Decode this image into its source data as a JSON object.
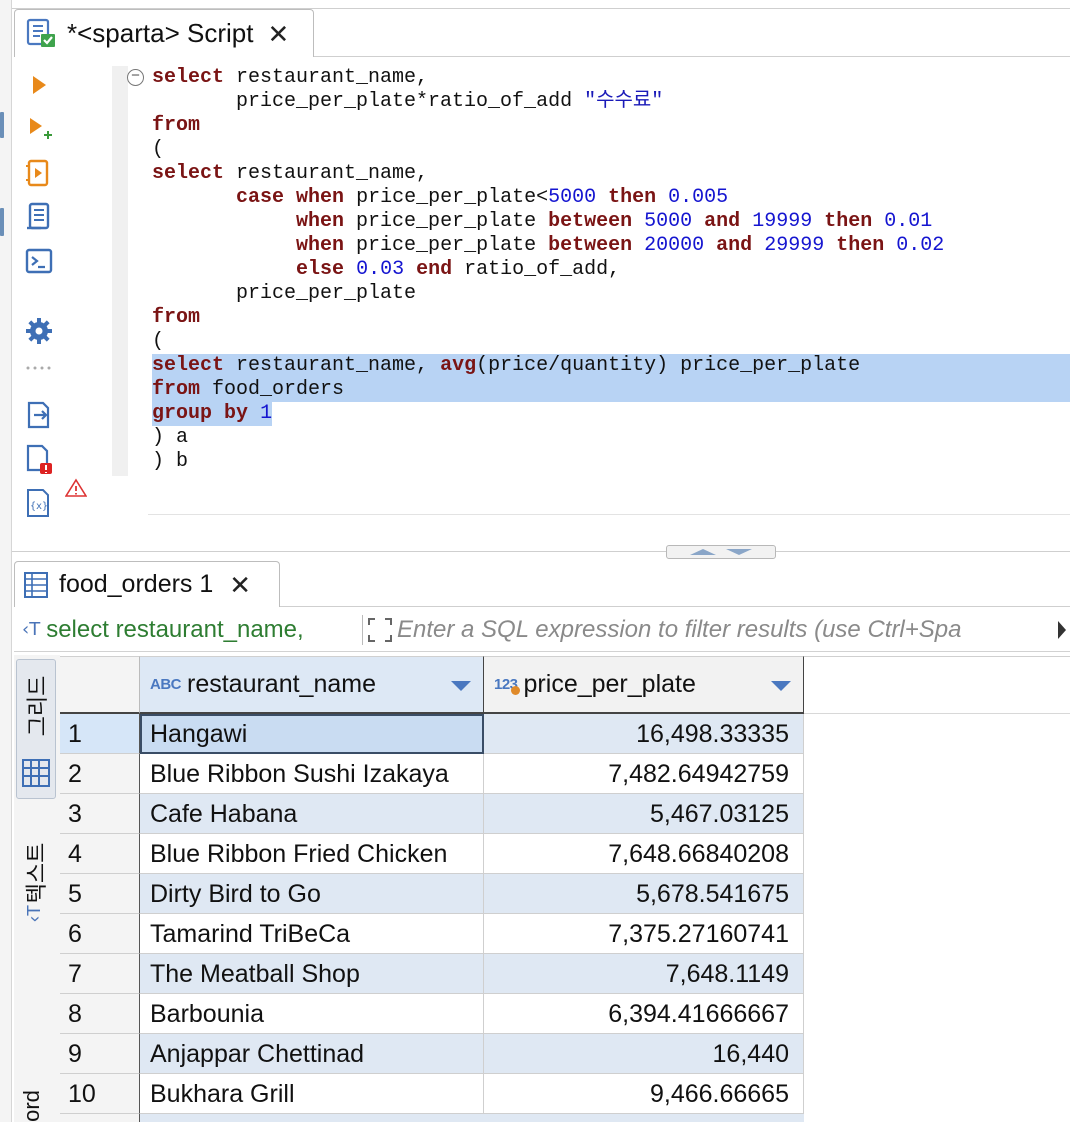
{
  "editor": {
    "tab_title": "*<sparta> Script",
    "close_glyph": "✕",
    "code_lines": [
      [
        {
          "k": "kw",
          "t": "select"
        },
        {
          "k": "",
          "t": " restaurant_name,"
        }
      ],
      [
        {
          "k": "",
          "t": "       price_per_plate*ratio_of_add "
        },
        {
          "k": "str",
          "t": "\"수수료\""
        }
      ],
      [
        {
          "k": "kw",
          "t": "from"
        }
      ],
      [
        {
          "k": "",
          "t": "("
        }
      ],
      [
        {
          "k": "kw",
          "t": "select"
        },
        {
          "k": "",
          "t": " restaurant_name,"
        }
      ],
      [
        {
          "k": "",
          "t": "       "
        },
        {
          "k": "kw",
          "t": "case"
        },
        {
          "k": "",
          "t": " "
        },
        {
          "k": "kw",
          "t": "when"
        },
        {
          "k": "",
          "t": " price_per_plate<"
        },
        {
          "k": "num",
          "t": "5000"
        },
        {
          "k": "",
          "t": " "
        },
        {
          "k": "kw",
          "t": "then"
        },
        {
          "k": "",
          "t": " "
        },
        {
          "k": "num",
          "t": "0.005"
        }
      ],
      [
        {
          "k": "",
          "t": "            "
        },
        {
          "k": "kw",
          "t": "when"
        },
        {
          "k": "",
          "t": " price_per_plate "
        },
        {
          "k": "kw",
          "t": "between"
        },
        {
          "k": "",
          "t": " "
        },
        {
          "k": "num",
          "t": "5000"
        },
        {
          "k": "",
          "t": " "
        },
        {
          "k": "kw",
          "t": "and"
        },
        {
          "k": "",
          "t": " "
        },
        {
          "k": "num",
          "t": "19999"
        },
        {
          "k": "",
          "t": " "
        },
        {
          "k": "kw",
          "t": "then"
        },
        {
          "k": "",
          "t": " "
        },
        {
          "k": "num",
          "t": "0.01"
        }
      ],
      [
        {
          "k": "",
          "t": "            "
        },
        {
          "k": "kw",
          "t": "when"
        },
        {
          "k": "",
          "t": " price_per_plate "
        },
        {
          "k": "kw",
          "t": "between"
        },
        {
          "k": "",
          "t": " "
        },
        {
          "k": "num",
          "t": "20000"
        },
        {
          "k": "",
          "t": " "
        },
        {
          "k": "kw",
          "t": "and"
        },
        {
          "k": "",
          "t": " "
        },
        {
          "k": "num",
          "t": "29999"
        },
        {
          "k": "",
          "t": " "
        },
        {
          "k": "kw",
          "t": "then"
        },
        {
          "k": "",
          "t": " "
        },
        {
          "k": "num",
          "t": "0.02"
        }
      ],
      [
        {
          "k": "",
          "t": "            "
        },
        {
          "k": "kw",
          "t": "else"
        },
        {
          "k": "",
          "t": " "
        },
        {
          "k": "num",
          "t": "0.03"
        },
        {
          "k": "",
          "t": " "
        },
        {
          "k": "kw",
          "t": "end"
        },
        {
          "k": "",
          "t": " ratio_of_add,"
        }
      ],
      [
        {
          "k": "",
          "t": "       price_per_plate"
        }
      ],
      [
        {
          "k": "kw",
          "t": "from"
        }
      ],
      [
        {
          "k": "",
          "t": "("
        }
      ],
      [
        {
          "k": "kw",
          "t": "select"
        },
        {
          "k": "",
          "t": " restaurant_name, "
        },
        {
          "k": "kw",
          "t": "avg"
        },
        {
          "k": "",
          "t": "(price/quantity) price_per_plate"
        }
      ],
      [
        {
          "k": "kw",
          "t": "from"
        },
        {
          "k": "",
          "t": " food_orders"
        }
      ],
      [
        {
          "k": "kw",
          "t": "group"
        },
        {
          "k": "",
          "t": " "
        },
        {
          "k": "kw",
          "t": "by"
        },
        {
          "k": "",
          "t": " "
        },
        {
          "k": "num",
          "t": "1"
        }
      ],
      [
        {
          "k": "",
          "t": ") a"
        }
      ],
      [
        {
          "k": "",
          "t": ") b"
        }
      ]
    ],
    "selected_lines": [
      12,
      13,
      14
    ],
    "selection_partial_widths": {
      "14": "120px"
    },
    "colors": {
      "keyword": "#7a1414",
      "number": "#1515d0",
      "selection": "#b8d3f4"
    }
  },
  "results": {
    "tab_title": "food_orders 1",
    "close_glyph": "✕",
    "filter_query": "select restaurant_name,",
    "filter_placeholder": "Enter a SQL expression to filter results (use Ctrl+Spa",
    "side_tabs": {
      "grid": "그리드",
      "text": "텍스트",
      "record": "ord"
    },
    "columns": [
      {
        "type_badge": "ABC",
        "label": "restaurant_name"
      },
      {
        "type_badge": "123",
        "label": "price_per_plate"
      }
    ],
    "rows": [
      {
        "num": "1",
        "name": "Hangawi",
        "price": "16,498.33335"
      },
      {
        "num": "2",
        "name": "Blue Ribbon Sushi Izakaya",
        "price": "7,482.64942759"
      },
      {
        "num": "3",
        "name": "Cafe Habana",
        "price": "5,467.03125"
      },
      {
        "num": "4",
        "name": "Blue Ribbon Fried Chicken",
        "price": "7,648.66840208"
      },
      {
        "num": "5",
        "name": "Dirty Bird to Go",
        "price": "5,678.541675"
      },
      {
        "num": "6",
        "name": "Tamarind TriBeCa",
        "price": "7,375.27160741"
      },
      {
        "num": "7",
        "name": "The Meatball Shop",
        "price": "7,648.1149"
      },
      {
        "num": "8",
        "name": "Barbounia",
        "price": "6,394.41666667"
      },
      {
        "num": "9",
        "name": "Anjappar Chettinad",
        "price": "16,440"
      },
      {
        "num": "10",
        "name": "Bukhara Grill",
        "price": "9,466.66665"
      }
    ],
    "selected_row": 0,
    "colors": {
      "alt_row": "#dfe8f3",
      "header_accent": "#4a78c0",
      "filter_query": "#2e7d32"
    }
  },
  "icons": {
    "toolbar": [
      "execute-statement-icon",
      "execute-in-new-tab-icon",
      "execute-script-icon",
      "explain-plan-icon",
      "open-console-icon",
      "settings-icon",
      "more-icon",
      "export-icon",
      "error-file-icon",
      "variables-icon"
    ],
    "warning": "warning-icon"
  }
}
